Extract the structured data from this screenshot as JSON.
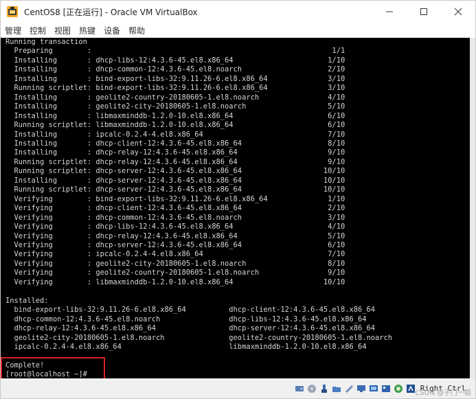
{
  "window": {
    "title": "CentOS8 [正在运行] - Oracle VM VirtualBox"
  },
  "menu": {
    "items": [
      "管理",
      "控制",
      "视图",
      "热键",
      "设备",
      "帮助"
    ]
  },
  "console": {
    "text": "Running transaction\n  Preparing        :                                                        1/1\n  Installing       : dhcp-libs-12:4.3.6-45.el8.x86_64                      1/10\n  Installing       : dhcp-common-12:4.3.6-45.el8.noarch                    2/10\n  Installing       : bind-export-libs-32:9.11.26-6.el8.x86_64              3/10\n  Running scriptlet: bind-export-libs-32:9.11.26-6.el8.x86_64              3/10\n  Installing       : geolite2-country-20180605-1.el8.noarch                4/10\n  Installing       : geolite2-city-20180605-1.el8.noarch                   5/10\n  Installing       : libmaxminddb-1.2.0-10.el8.x86_64                      6/10\n  Running scriptlet: libmaxminddb-1.2.0-10.el8.x86_64                      6/10\n  Installing       : ipcalc-0.2.4-4.el8.x86_64                             7/10\n  Installing       : dhcp-client-12:4.3.6-45.el8.x86_64                    8/10\n  Installing       : dhcp-relay-12:4.3.6-45.el8.x86_64                     9/10\n  Running scriptlet: dhcp-relay-12:4.3.6-45.el8.x86_64                     9/10\n  Running scriptlet: dhcp-server-12:4.3.6-45.el8.x86_64                   10/10\n  Installing       : dhcp-server-12:4.3.6-45.el8.x86_64                   10/10\n  Running scriptlet: dhcp-server-12:4.3.6-45.el8.x86_64                   10/10\n  Verifying        : bind-export-libs-32:9.11.26-6.el8.x86_64              1/10\n  Verifying        : dhcp-client-12:4.3.6-45.el8.x86_64                    2/10\n  Verifying        : dhcp-common-12:4.3.6-45.el8.noarch                    3/10\n  Verifying        : dhcp-libs-12:4.3.6-45.el8.x86_64                      4/10\n  Verifying        : dhcp-relay-12:4.3.6-45.el8.x86_64                     5/10\n  Verifying        : dhcp-server-12:4.3.6-45.el8.x86_64                    6/10\n  Verifying        : ipcalc-0.2.4-4.el8.x86_64                             7/10\n  Verifying        : geolite2-city-20180605-1.el8.noarch                   8/10\n  Verifying        : geolite2-country-20180605-1.el8.noarch                9/10\n  Verifying        : libmaxminddb-1.2.0-10.el8.x86_64                     10/10\n\nInstalled:\n  bind-export-libs-32:9.11.26-6.el8.x86_64          dhcp-client-12:4.3.6-45.el8.x86_64\n  dhcp-common-12:4.3.6-45.el8.noarch                dhcp-libs-12:4.3.6-45.el8.x86_64\n  dhcp-relay-12:4.3.6-45.el8.x86_64                 dhcp-server-12:4.3.6-45.el8.x86_64\n  geolite2-city-20180605-1.el8.noarch               geolite2-country-20180605-1.el8.noarch\n  ipcalc-0.2.4-4.el8.x86_64                         libmaxminddb-1.2.0-10.el8.x86_64\n\nComplete!\n[root@localhost ~]#"
  },
  "statusbar": {
    "host_key": "Right Ctrl",
    "icons": [
      "hard-disk-icon",
      "optical-drive-icon",
      "usb-icon",
      "shared-folders-icon",
      "display-icon",
      "network-icon",
      "recording-icon",
      "mouse-integration-icon",
      "cpu-icon",
      "host-key-icon"
    ]
  },
  "watermark": {
    "text": "CSDN @子门一姐"
  },
  "colors": {
    "console_bg": "#000000",
    "console_fg": "#d6d6d6",
    "highlight": "#e02020"
  }
}
